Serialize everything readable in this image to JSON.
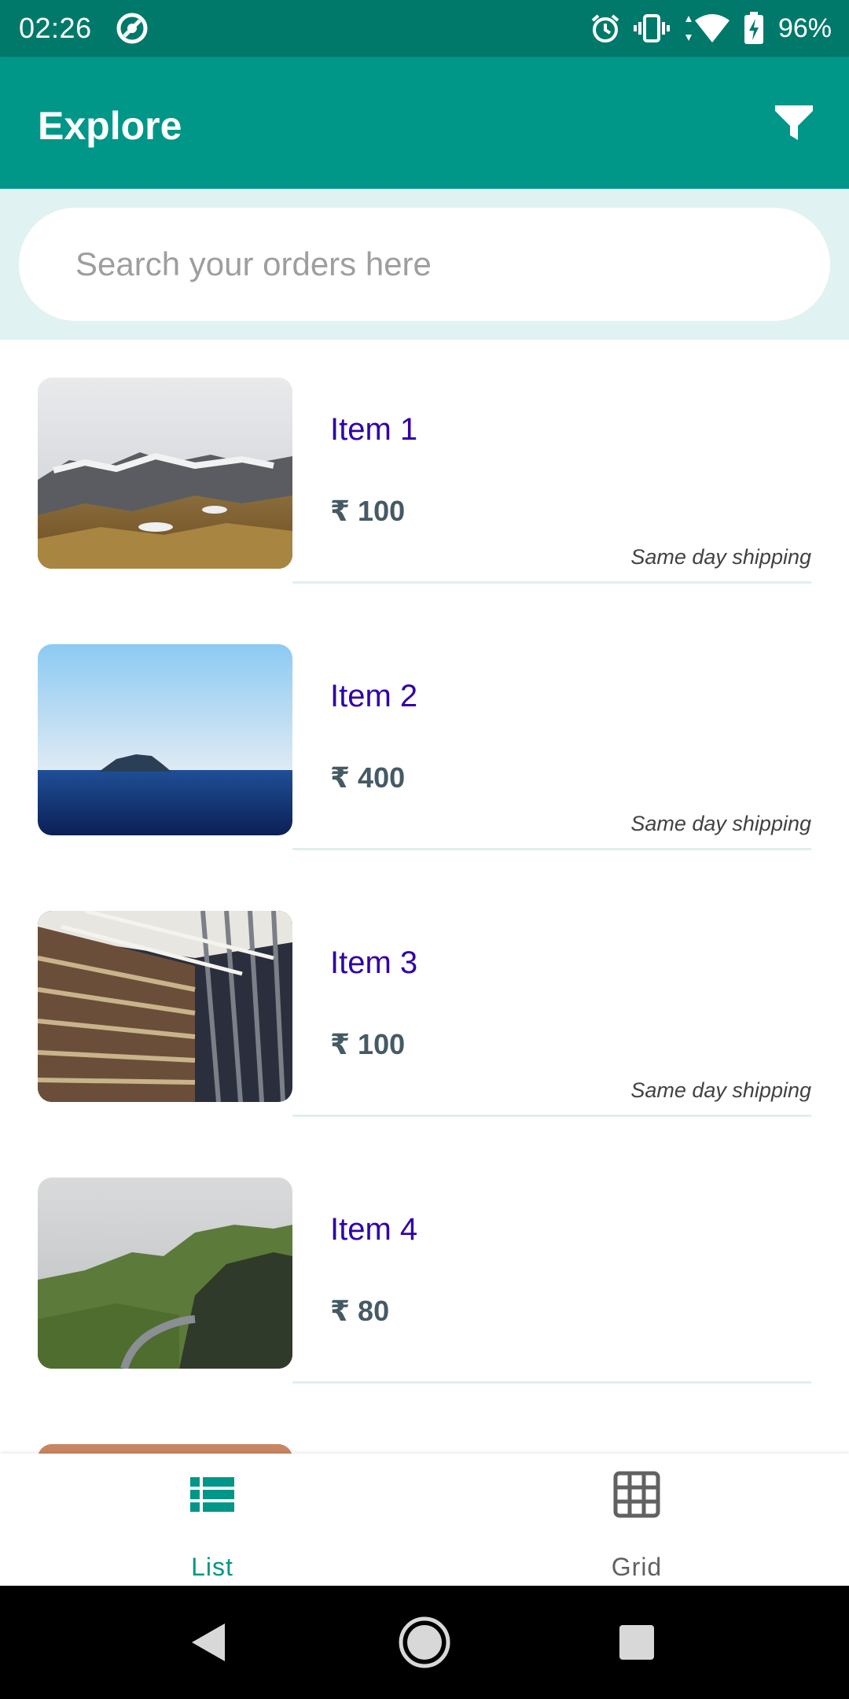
{
  "status_bar": {
    "time": "02:26",
    "battery": "96%"
  },
  "app_bar": {
    "title": "Explore"
  },
  "search": {
    "placeholder": "Search your orders here"
  },
  "items": [
    {
      "name": "Item 1",
      "price": "₹ 100",
      "shipping": "Same day shipping"
    },
    {
      "name": "Item 2",
      "price": "₹ 400",
      "shipping": "Same day shipping"
    },
    {
      "name": "Item 3",
      "price": "₹ 100",
      "shipping": "Same day shipping"
    },
    {
      "name": "Item 4",
      "price": "₹ 80",
      "shipping": ""
    }
  ],
  "bottom_nav": {
    "list_label": "List",
    "grid_label": "Grid"
  },
  "colors": {
    "status_bar": "#00796b",
    "app_bar": "#009688",
    "search_band": "#e0f2f1",
    "item_name": "#3100a8",
    "price": "#455a64",
    "nav_active": "#009688",
    "nav_inactive": "#616161"
  }
}
